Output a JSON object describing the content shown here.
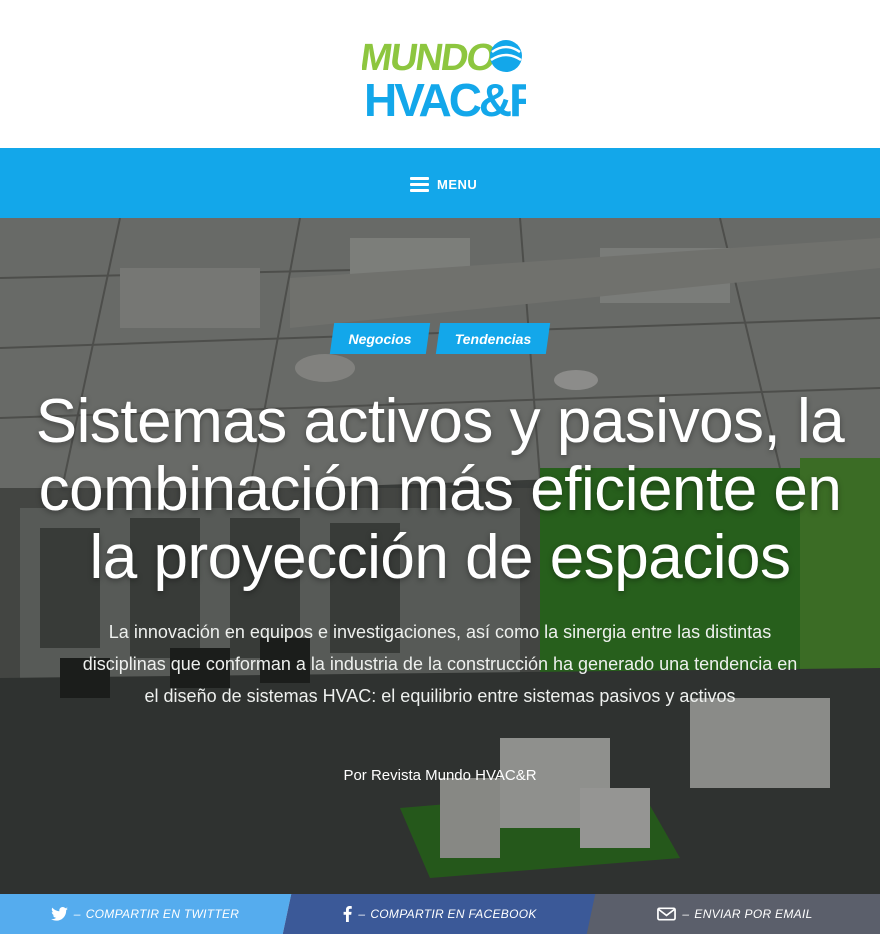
{
  "header": {
    "logo_line1": "MUNDO",
    "logo_line2": "HVAC&R",
    "logo_color_green": "#8dc63f",
    "logo_color_blue": "#1565c0",
    "logo_color_cyan": "#13a7ea"
  },
  "nav": {
    "menu_label": "MENU",
    "color": "#13a7ea"
  },
  "article": {
    "categories": [
      "Negocios",
      "Tendencias"
    ],
    "title": "Sistemas activos y pasivos, la combinación más eficiente en la proyección de espacios",
    "subtitle": "La innovación en equipos e investigaciones, así como la sinergia entre las distintas disciplinas que conforman a la industria de la construcción ha generado una tendencia en el diseño de sistemas HVAC: el equilibrio entre sistemas pasivos y activos",
    "byline": "Por Revista Mundo HVAC&R"
  },
  "share": {
    "twitter_label": "COMPARTIR EN TWITTER",
    "facebook_label": "COMPARTIR EN FACEBOOK",
    "email_label": "ENVIAR POR EMAIL",
    "separator": "–",
    "twitter_color": "#55acee",
    "facebook_color": "#3b5998",
    "email_color": "#5b5f6b",
    "icons": [
      "twitter-icon",
      "facebook-icon",
      "envelope-icon"
    ]
  }
}
